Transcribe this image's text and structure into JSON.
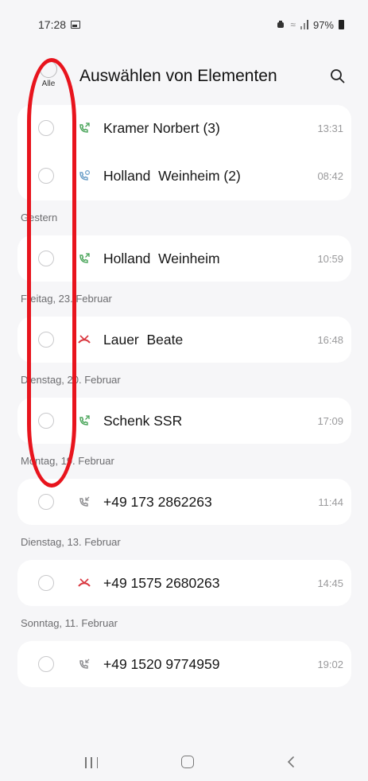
{
  "status_bar": {
    "time": "17:28",
    "battery": "97%",
    "icons": [
      "photo-icon",
      "alarm-icon",
      "wifi-icon",
      "signal-icon",
      "battery-icon"
    ]
  },
  "header": {
    "select_all_label": "Alle",
    "title": "Auswählen von Elementen",
    "search_icon": "search-icon"
  },
  "colors": {
    "accent_green": "#4aa55a",
    "missed_red": "#d9363e",
    "annotation_red": "#e8141d",
    "card_bg": "#ffffff",
    "page_bg": "#f6f6f8"
  },
  "calls": {
    "today": [
      {
        "name": "Kramer Norbert (3)",
        "time": "13:31",
        "type": "outgoing",
        "icon": "outgoing-call-icon"
      },
      {
        "name": "Holland  Weinheim (2)",
        "time": "08:42",
        "type": "rcs",
        "icon": "incoming-call-icon"
      }
    ],
    "groups": [
      {
        "date": "Gestern",
        "name": "Holland  Weinheim",
        "time": "10:59",
        "type": "outgoing",
        "icon": "outgoing-call-icon"
      },
      {
        "date": "Freitag, 23. Februar",
        "name": "Lauer  Beate",
        "time": "16:48",
        "type": "missed",
        "icon": "missed-call-icon"
      },
      {
        "date": "Dienstag, 20. Februar",
        "name": "Schenk SSR",
        "time": "17:09",
        "type": "outgoing",
        "icon": "outgoing-call-icon"
      },
      {
        "date": "Montag, 19. Februar",
        "name": "+49 173 2862263",
        "time": "11:44",
        "type": "incoming",
        "icon": "incoming-call-icon"
      },
      {
        "date": "Dienstag, 13. Februar",
        "name": "+49 1575 2680263",
        "time": "14:45",
        "type": "missed",
        "icon": "missed-call-icon"
      },
      {
        "date": "Sonntag, 11. Februar",
        "name": "+49 1520 9774959",
        "time": "19:02",
        "type": "incoming",
        "icon": "incoming-call-icon"
      }
    ]
  },
  "nav": {
    "recent_icon": "recent-apps-icon",
    "home_icon": "home-icon",
    "back_icon": "back-icon"
  }
}
